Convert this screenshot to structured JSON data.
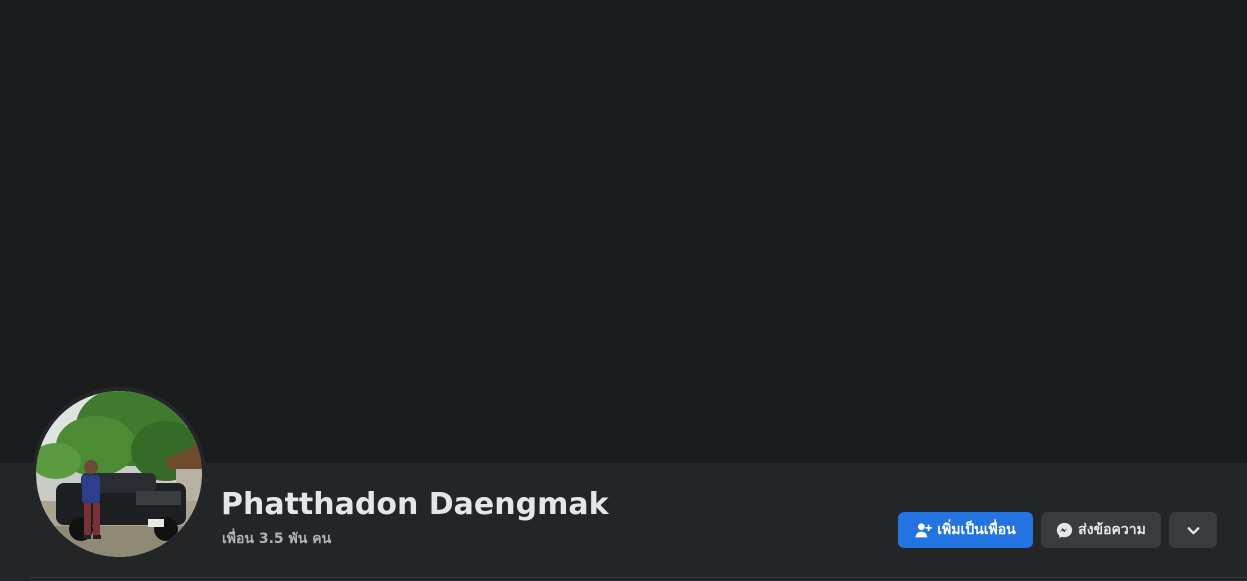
{
  "profile": {
    "name": "Phatthadon Daengmak",
    "friends_text": "เพื่อน 3.5 พัน คน"
  },
  "actions": {
    "add_friend_label": "เพิ่มเป็นเพื่อน",
    "message_label": "ส่งข้อความ",
    "more_icon": "chevron-down-icon",
    "add_friend_icon": "person-add-icon",
    "message_icon": "messenger-icon"
  },
  "colors": {
    "cover_bg": "#1a1b1d",
    "header_bg": "#242526",
    "primary_button": "#2374e1",
    "secondary_button": "#3a3b3c",
    "name_text": "#e4e6eb",
    "meta_text": "#b0b3b8"
  }
}
